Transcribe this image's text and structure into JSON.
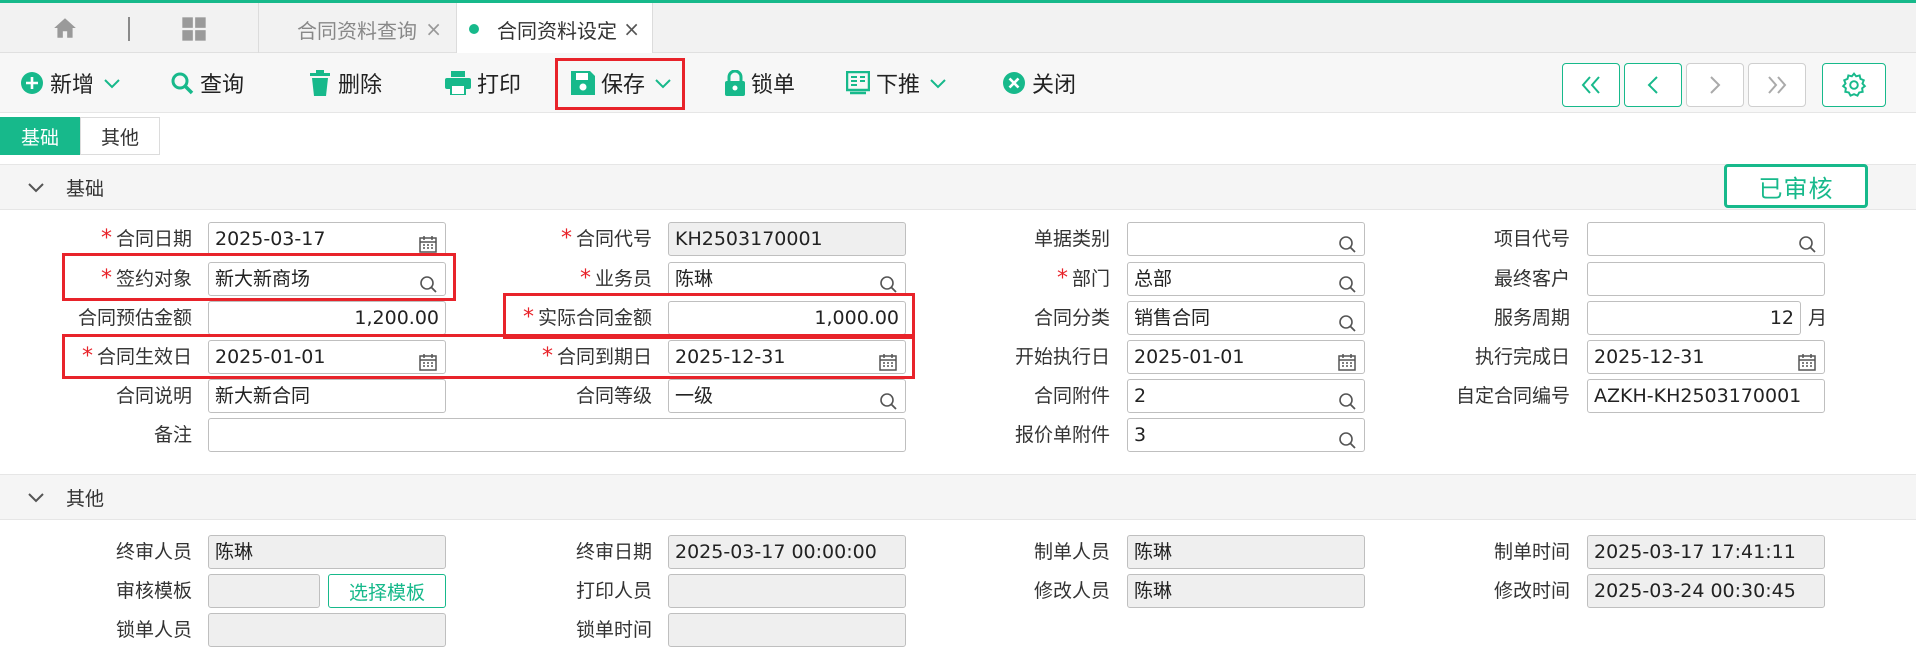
{
  "tabbar": {
    "tabs": [
      {
        "label": "合同资料查询"
      },
      {
        "label": "合同资料设定"
      }
    ],
    "close_glyph": "×"
  },
  "toolbar": {
    "new": "新增",
    "query": "查询",
    "delete": "删除",
    "print": "打印",
    "save": "保存",
    "lock": "锁单",
    "push": "下推",
    "close": "关闭"
  },
  "subtabs": [
    "基础",
    "其他"
  ],
  "status": "已审核",
  "basic": {
    "title": "基础",
    "contract_date": {
      "label": "合同日期",
      "value": "2025-03-17"
    },
    "sign_party": {
      "label": "签约对象",
      "value": "新大新商场"
    },
    "est_amount": {
      "label": "合同预估金额",
      "value": "1,200.00"
    },
    "effective_date": {
      "label": "合同生效日",
      "value": "2025-01-01"
    },
    "desc": {
      "label": "合同说明",
      "value": "新大新合同"
    },
    "remark": {
      "label": "备注",
      "value": ""
    },
    "contract_code": {
      "label": "合同代号",
      "value": "KH2503170001"
    },
    "salesman": {
      "label": "业务员",
      "value": "陈琳"
    },
    "actual_amount": {
      "label": "实际合同金额",
      "value": "1,000.00"
    },
    "expiry_date": {
      "label": "合同到期日",
      "value": "2025-12-31"
    },
    "grade": {
      "label": "合同等级",
      "value": "一级"
    },
    "doc_type": {
      "label": "单据类别",
      "value": ""
    },
    "dept": {
      "label": "部门",
      "value": "总部"
    },
    "category": {
      "label": "合同分类",
      "value": "销售合同"
    },
    "start_exec": {
      "label": "开始执行日",
      "value": "2025-01-01"
    },
    "attachment": {
      "label": "合同附件",
      "value": "2"
    },
    "quote_attachment": {
      "label": "报价单附件",
      "value": "3"
    },
    "project_code": {
      "label": "项目代号",
      "value": ""
    },
    "end_customer": {
      "label": "最终客户",
      "value": ""
    },
    "service_period": {
      "label": "服务周期",
      "value": "12",
      "unit": "月"
    },
    "exec_done": {
      "label": "执行完成日",
      "value": "2025-12-31"
    },
    "custom_no": {
      "label": "自定合同编号",
      "value": "AZKH-KH2503170001"
    }
  },
  "other": {
    "title": "其他",
    "final_reviewer": {
      "label": "终审人员",
      "value": "陈琳"
    },
    "review_template": {
      "label": "审核模板",
      "value": "",
      "button": "选择模板"
    },
    "lock_person": {
      "label": "锁单人员",
      "value": ""
    },
    "final_date": {
      "label": "终审日期",
      "value": "2025-03-17 00:00:00"
    },
    "printer": {
      "label": "打印人员",
      "value": ""
    },
    "lock_time": {
      "label": "锁单时间",
      "value": ""
    },
    "creator": {
      "label": "制单人员",
      "value": "陈琳"
    },
    "modifier": {
      "label": "修改人员",
      "value": "陈琳"
    },
    "create_time": {
      "label": "制单时间",
      "value": "2025-03-17 17:41:11"
    },
    "modify_time": {
      "label": "修改时间",
      "value": "2025-03-24 00:30:45"
    }
  },
  "colors": {
    "accent": "#17b98b",
    "highlight": "#e8232a"
  }
}
